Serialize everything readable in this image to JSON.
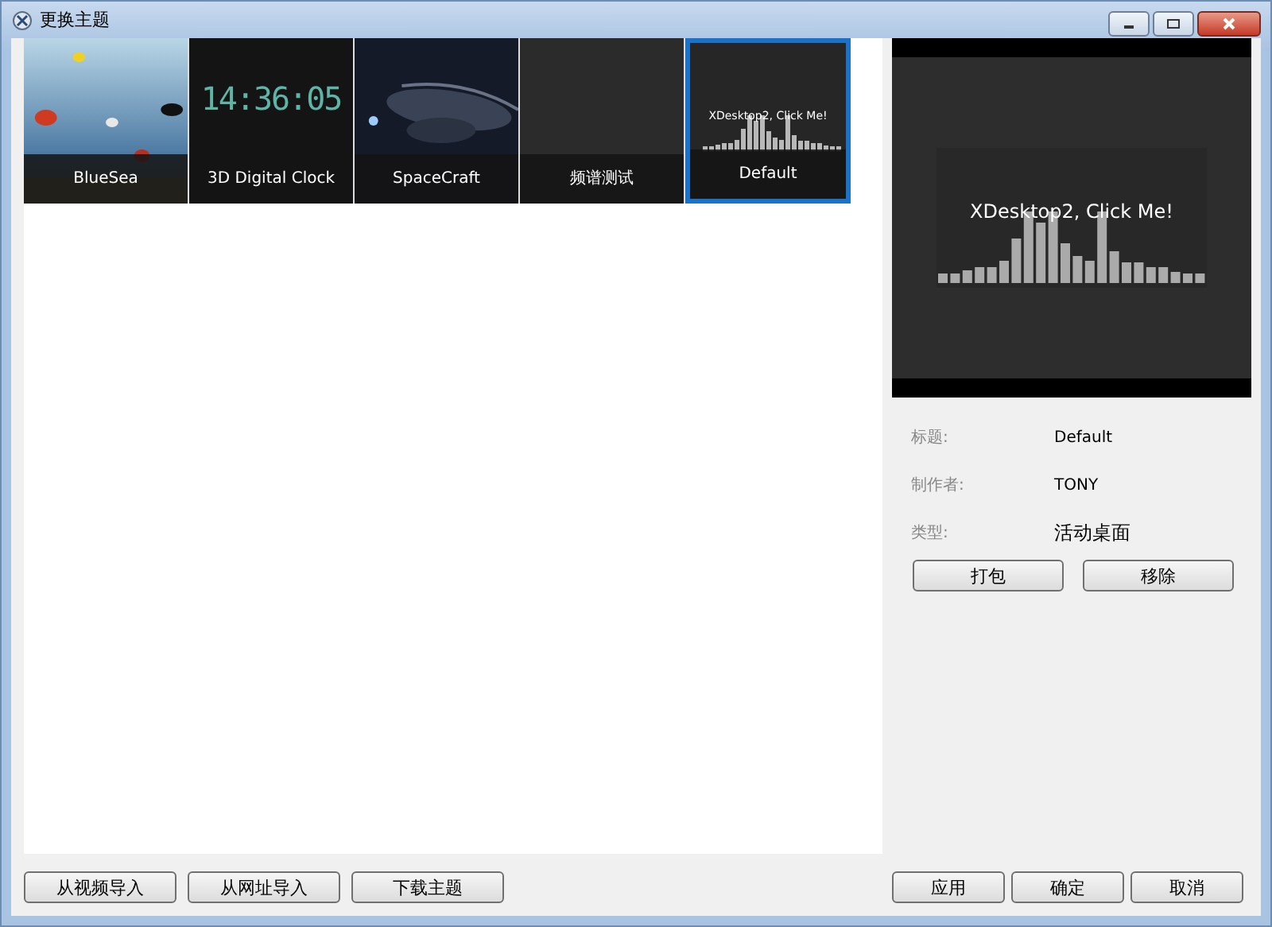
{
  "window": {
    "title": "更换主题"
  },
  "themes": [
    {
      "kind": "sea",
      "label": "BlueSea",
      "selected": false
    },
    {
      "kind": "clock",
      "label": "3D Digital Clock",
      "clock_text": "14:36:05",
      "selected": false
    },
    {
      "kind": "space",
      "label": "SpaceCraft",
      "selected": false
    },
    {
      "kind": "blank",
      "label": "频谱测试",
      "selected": false
    },
    {
      "kind": "spectrum",
      "label": "Default",
      "preview_text": "XDesktop2, Click Me!",
      "selected": true
    }
  ],
  "preview": {
    "text": "XDesktop2, Click Me!"
  },
  "details": [
    {
      "label": "标题:",
      "value": "Default"
    },
    {
      "label": "制作者:",
      "value": "TONY"
    },
    {
      "label": "类型:",
      "value": "活动桌面"
    }
  ],
  "detail_buttons": [
    "打包",
    "移除"
  ],
  "import_buttons": [
    "从视频导入",
    "从网址导入",
    "下载主题"
  ],
  "dialog_buttons": [
    "应用",
    "确定",
    "取消"
  ]
}
